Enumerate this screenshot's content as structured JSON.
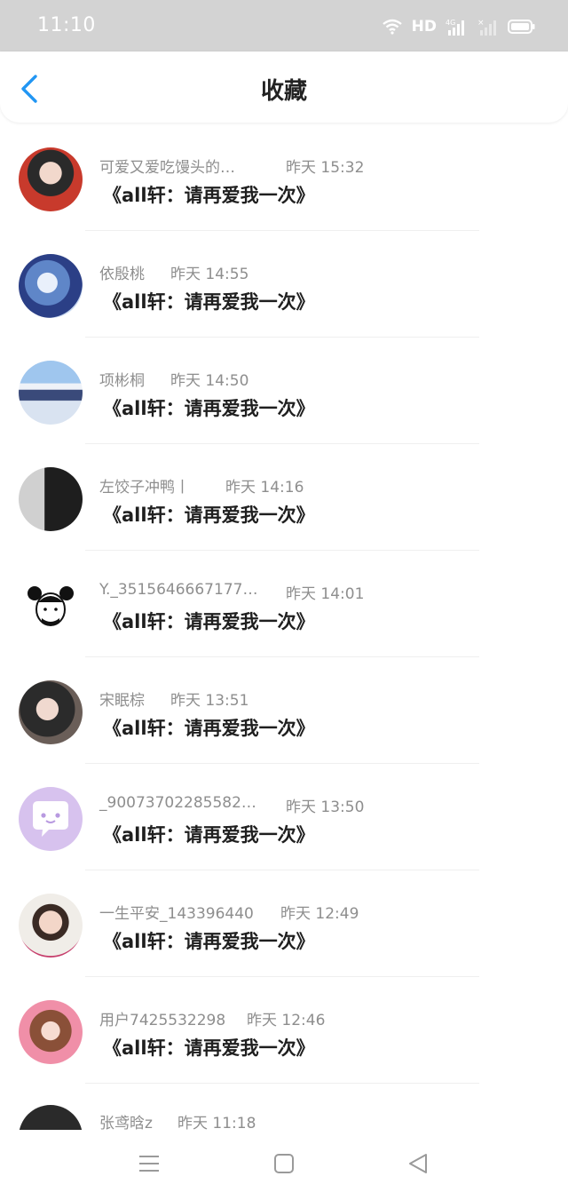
{
  "status_bar": {
    "time": "11:10",
    "network": "HD",
    "signal_label": "4G"
  },
  "header": {
    "title": "收藏"
  },
  "items": [
    {
      "name": "可爱又爱吃馒头的…",
      "time": "昨天 15:32",
      "message": "《all轩：请再爱我一次》"
    },
    {
      "name": "依殷桃",
      "time": "昨天 14:55",
      "message": "《all轩：请再爱我一次》"
    },
    {
      "name": "项彬桐",
      "time": "昨天 14:50",
      "message": "《all轩：请再爱我一次》"
    },
    {
      "name": "左饺子冲鸭丨",
      "time": "昨天 14:16",
      "message": "《all轩：请再爱我一次》"
    },
    {
      "name": "Y._3515646667177…",
      "time": "昨天 14:01",
      "message": "《all轩：请再爱我一次》"
    },
    {
      "name": "宋眠棕",
      "time": "昨天 13:51",
      "message": "《all轩：请再爱我一次》"
    },
    {
      "name": "_90073702285582…",
      "time": "昨天 13:50",
      "message": "《all轩：请再爱我一次》"
    },
    {
      "name": "一生平安_143396440",
      "time": "昨天 12:49",
      "message": "《all轩：请再爱我一次》"
    },
    {
      "name": "用户7425532298",
      "time": "昨天 12:46",
      "message": "《all轩：请再爱我一次》"
    },
    {
      "name": "张鸢晗z",
      "time": "昨天 11:18",
      "message": ""
    }
  ],
  "colors": {
    "accent": "#2196f3",
    "status_bar": "#d3d3d3",
    "meta_text": "#8e8e8e"
  }
}
